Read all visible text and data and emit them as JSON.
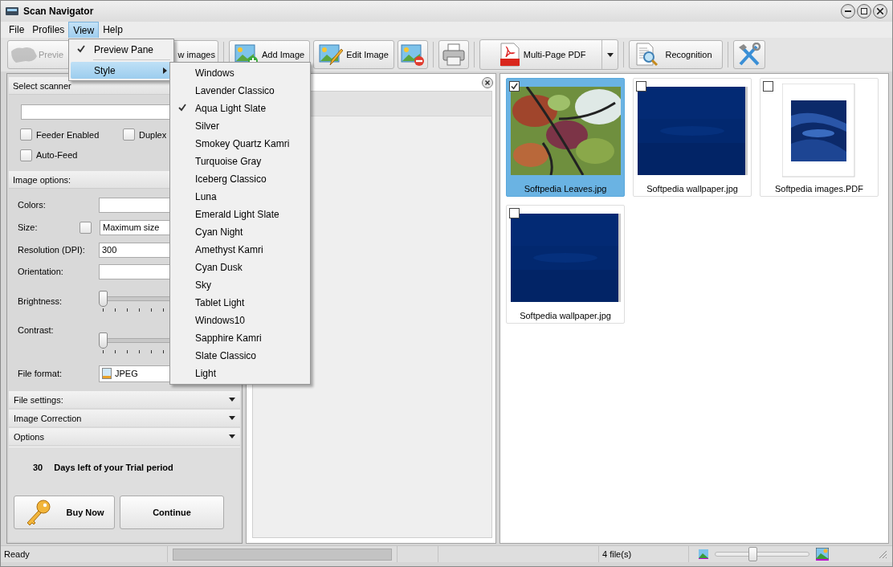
{
  "window": {
    "title": "Scan Navigator"
  },
  "menu_bar": [
    {
      "label": "File",
      "selected": false
    },
    {
      "label": "Profiles",
      "selected": false
    },
    {
      "label": "View",
      "selected": true
    },
    {
      "label": "Help",
      "selected": false
    }
  ],
  "view_menu": [
    {
      "label": "Preview Pane",
      "kind": "item",
      "checked": true,
      "selected": false
    },
    {
      "label": "Style",
      "kind": "submenu",
      "checked": false,
      "selected": true
    }
  ],
  "style_menu": [
    {
      "label": "Windows",
      "checked": false
    },
    {
      "label": "Lavender Classico",
      "checked": false
    },
    {
      "label": "Aqua Light Slate",
      "checked": true
    },
    {
      "label": "Silver",
      "checked": false
    },
    {
      "label": "Smokey Quartz Kamri",
      "checked": false
    },
    {
      "label": "Turquoise Gray",
      "checked": false
    },
    {
      "label": "Iceberg Classico",
      "checked": false
    },
    {
      "label": "Luna",
      "checked": false
    },
    {
      "label": "Emerald Light Slate",
      "checked": false
    },
    {
      "label": "Cyan Night",
      "checked": false
    },
    {
      "label": "Amethyst Kamri",
      "checked": false
    },
    {
      "label": "Cyan Dusk",
      "checked": false
    },
    {
      "label": "Sky",
      "checked": false
    },
    {
      "label": "Tablet Light",
      "checked": false
    },
    {
      "label": "Windows10",
      "checked": false
    },
    {
      "label": "Sapphire Kamri",
      "checked": false
    },
    {
      "label": "Slate Classico",
      "checked": false
    },
    {
      "label": "Light",
      "checked": false
    }
  ],
  "toolbar": [
    {
      "kind": "scanner",
      "label": "Previe",
      "disabled": true
    },
    {
      "kind": "text",
      "label": "w images",
      "disabled": false
    },
    {
      "kind": "add",
      "label": "Add Image",
      "disabled": false
    },
    {
      "kind": "edit",
      "label": "Edit Image",
      "disabled": false
    },
    {
      "kind": "remove",
      "disabled": false
    },
    {
      "kind": "print",
      "disabled": false
    },
    {
      "kind": "pdf",
      "label": "Multi-Page PDF",
      "disabled": false
    },
    {
      "kind": "recognition",
      "label": "Recognition",
      "disabled": false
    },
    {
      "kind": "tools",
      "disabled": false
    }
  ],
  "scanner_panel": {
    "title": "Select scanner",
    "checkboxes": [
      {
        "label": "Feeder Enabled",
        "checked": false
      },
      {
        "label": "Duplex",
        "checked": false
      },
      {
        "label": "Auto-Feed",
        "checked": false
      }
    ]
  },
  "image_options": {
    "title": "Image options:",
    "colors": {
      "label": "Colors:"
    },
    "size": {
      "label": "Size:",
      "checked": false,
      "value": "Maximum size"
    },
    "resolution": {
      "label": "Resolution (DPI):",
      "value": "300"
    },
    "orientation": {
      "label": "Orientation:"
    },
    "brightness": {
      "label": "Brightness:",
      "level": 0
    },
    "contrast": {
      "label": "Contrast:",
      "level": 0
    },
    "file_format": {
      "label": "File format:",
      "value": "JPEG"
    }
  },
  "sections": [
    {
      "label": "File settings:",
      "expanded": false
    },
    {
      "label": "Image Correction",
      "expanded": false
    },
    {
      "label": "Options",
      "expanded": false
    }
  ],
  "trial": {
    "days": "30",
    "message": "Days left of your Trial period",
    "buy_button": "Buy Now",
    "continue_button": "Continue"
  },
  "thumbnails": [
    {
      "name": "Softpedia Leaves.jpg",
      "checked": true,
      "selected": true
    },
    {
      "name": "Softpedia wallpaper.jpg",
      "kind": "wallpaper",
      "checked": false,
      "selected": false
    },
    {
      "name": "Softpedia images.PDF",
      "kind": "document",
      "checked": false,
      "selected": false
    },
    {
      "name": "Softpedia wallpaper.jpg",
      "kind": "wallpaper",
      "checked": false,
      "selected": false
    }
  ],
  "status_bar": {
    "status": "Ready",
    "progress": {
      "level": 0
    },
    "file_count": "4 file(s)",
    "zoom": {
      "level": 0.4
    }
  }
}
